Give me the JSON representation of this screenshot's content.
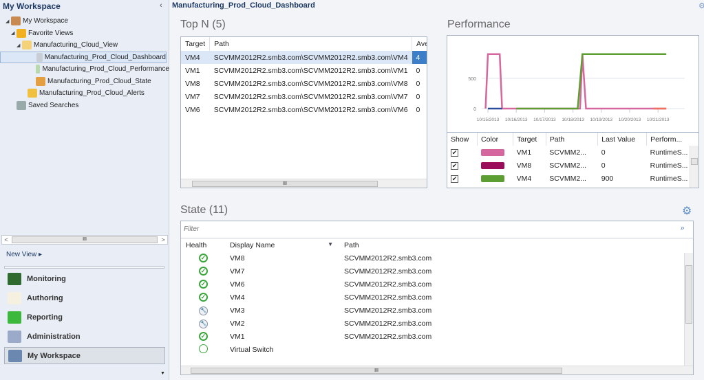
{
  "sidebar": {
    "title": "My Workspace",
    "tree": [
      {
        "label": "My Workspace",
        "indent": 1,
        "icon": "user-icon"
      },
      {
        "label": "Favorite Views",
        "indent": 2,
        "icon": "star-icon"
      },
      {
        "label": "Manufacturing_Cloud_View",
        "indent": 3,
        "icon": "folder-icon"
      },
      {
        "label": "Manufacturing_Prod_Cloud_Dashboard",
        "indent": 4,
        "icon": "dashboard-icon",
        "selected": true
      },
      {
        "label": "Manufacturing_Prod_Cloud_Performance",
        "indent": 4,
        "icon": "performance-icon"
      },
      {
        "label": "Manufacturing_Prod_Cloud_State",
        "indent": 4,
        "icon": "state-icon"
      },
      {
        "label": "Manufacturing_Prod_Cloud_Alerts",
        "indent": 3,
        "icon": "alert-icon"
      },
      {
        "label": "Saved Searches",
        "indent": 2,
        "icon": "search-icon"
      }
    ],
    "new_view": "New View ▸",
    "wunderbar": [
      {
        "label": "Monitoring",
        "icon": "monitoring-icon"
      },
      {
        "label": "Authoring",
        "icon": "authoring-icon"
      },
      {
        "label": "Reporting",
        "icon": "reporting-icon"
      },
      {
        "label": "Administration",
        "icon": "gear-icon"
      },
      {
        "label": "My Workspace",
        "icon": "workspace-icon",
        "selected": true
      }
    ]
  },
  "main": {
    "title": "Manufacturing_Prod_Cloud_Dashboard",
    "topn": {
      "title": "Top N (5)",
      "columns": [
        "Target",
        "Path",
        "Ave"
      ],
      "rows": [
        [
          "VM4",
          "SCVMM2012R2.smb3.com\\SCVMM2012R2.smb3.com\\VM4",
          "4"
        ],
        [
          "VM1",
          "SCVMM2012R2.smb3.com\\SCVMM2012R2.smb3.com\\VM1",
          "0"
        ],
        [
          "VM8",
          "SCVMM2012R2.smb3.com\\SCVMM2012R2.smb3.com\\VM8",
          "0"
        ],
        [
          "VM7",
          "SCVMM2012R2.smb3.com\\SCVMM2012R2.smb3.com\\VM7",
          "0"
        ],
        [
          "VM6",
          "SCVMM2012R2.smb3.com\\SCVMM2012R2.smb3.com\\VM6",
          "0"
        ]
      ]
    },
    "performance": {
      "title": "Performance",
      "legend_columns": [
        "Show",
        "Color",
        "Target",
        "Path",
        "Last Value",
        "Perform..."
      ],
      "legend_rows": [
        {
          "color": "#d4679e",
          "target": "VM1",
          "path": "SCVMM2...",
          "last": "0",
          "perf": "RuntimeS..."
        },
        {
          "color": "#9b0d5a",
          "target": "VM8",
          "path": "SCVMM2...",
          "last": "0",
          "perf": "RuntimeS..."
        },
        {
          "color": "#5c9e32",
          "target": "VM4",
          "path": "SCVMM2...",
          "last": "900",
          "perf": "RuntimeS..."
        }
      ]
    },
    "state": {
      "title": "State (11)",
      "filter_placeholder": "Filter",
      "columns": [
        "Health",
        "Display Name",
        "Path"
      ],
      "rows": [
        {
          "health": "healthy",
          "name": "VM8",
          "path": "SCVMM2012R2.smb3.com"
        },
        {
          "health": "healthy",
          "name": "VM7",
          "path": "SCVMM2012R2.smb3.com"
        },
        {
          "health": "healthy",
          "name": "VM6",
          "path": "SCVMM2012R2.smb3.com"
        },
        {
          "health": "healthy",
          "name": "VM4",
          "path": "SCVMM2012R2.smb3.com"
        },
        {
          "health": "maintenance",
          "name": "VM3",
          "path": "SCVMM2012R2.smb3.com"
        },
        {
          "health": "maintenance",
          "name": "VM2",
          "path": "SCVMM2012R2.smb3.com"
        },
        {
          "health": "healthy",
          "name": "VM1",
          "path": "SCVMM2012R2.smb3.com"
        },
        {
          "health": "not-monitored",
          "name": "Virtual Switch",
          "path": ""
        }
      ]
    }
  },
  "chart_data": {
    "type": "line",
    "x_ticks": [
      "10/15/2013",
      "10/16/2013",
      "10/17/2013",
      "10/18/2013",
      "10/19/2013",
      "10/20/2013",
      "10/21/2013"
    ],
    "y_ticks": [
      0,
      500
    ],
    "ylim": [
      0,
      1000
    ],
    "grid": true,
    "series": [
      {
        "name": "VM1",
        "color": "#d4679e",
        "points": [
          [
            "10/14/2013 22:00",
            0
          ],
          [
            "10/15/2013 00:00",
            900
          ],
          [
            "10/15/2013 10:00",
            900
          ],
          [
            "10/15/2013 12:00",
            0
          ],
          [
            "10/18/2013 06:00",
            0
          ],
          [
            "10/18/2013 08:00",
            900
          ],
          [
            "10/18/2013 11:00",
            0
          ],
          [
            "10/21/2013 07:00",
            0
          ]
        ]
      },
      {
        "name": "VM8",
        "color": "#2a4a9a",
        "points": [
          [
            "10/15/2013 00:00",
            0
          ],
          [
            "10/15/2013 12:00",
            0
          ]
        ]
      },
      {
        "name": "VM4",
        "color": "#5c9e32",
        "points": [
          [
            "10/16/2013 00:00",
            0
          ],
          [
            "10/18/2013 04:00",
            0
          ],
          [
            "10/18/2013 08:00",
            900
          ],
          [
            "10/21/2013 07:00",
            900
          ]
        ]
      },
      {
        "color": "#f07060",
        "points": [
          [
            "10/20/2013 20:00",
            0
          ],
          [
            "10/21/2013 07:00",
            0
          ]
        ]
      }
    ]
  }
}
